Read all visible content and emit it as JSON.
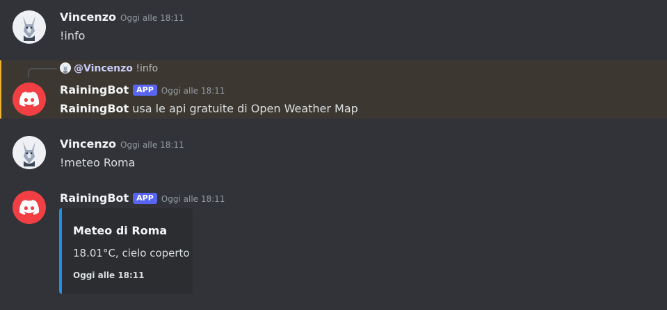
{
  "messages": [
    {
      "author": "Vincenzo",
      "time": "Oggi alle 18:11",
      "content": "!info"
    },
    {
      "reply": {
        "mention": "@Vincenzo",
        "text": "!info"
      },
      "author": "RainingBot",
      "badge": "APP",
      "time": "Oggi alle 18:11",
      "content_bold": "RainingBot",
      "content": " usa le api gratuite di Open Weather Map"
    },
    {
      "author": "Vincenzo",
      "time": "Oggi alle 18:11",
      "content": "!meteo Roma"
    },
    {
      "author": "RainingBot",
      "badge": "APP",
      "time": "Oggi alle 18:11",
      "embed": {
        "title": "Meteo di Roma",
        "description": "18.01°C, cielo coperto",
        "footer": "Oggi alle 18:11"
      }
    }
  ],
  "colors": {
    "background": "#313338",
    "highlight": "#3c3831",
    "embed_accent": "#1e90e8",
    "bot_avatar": "#f23f43",
    "badge": "#5865f2"
  },
  "icons": {
    "user_avatar": "wolf-avatar-icon",
    "bot_avatar": "discord-logo-icon"
  }
}
